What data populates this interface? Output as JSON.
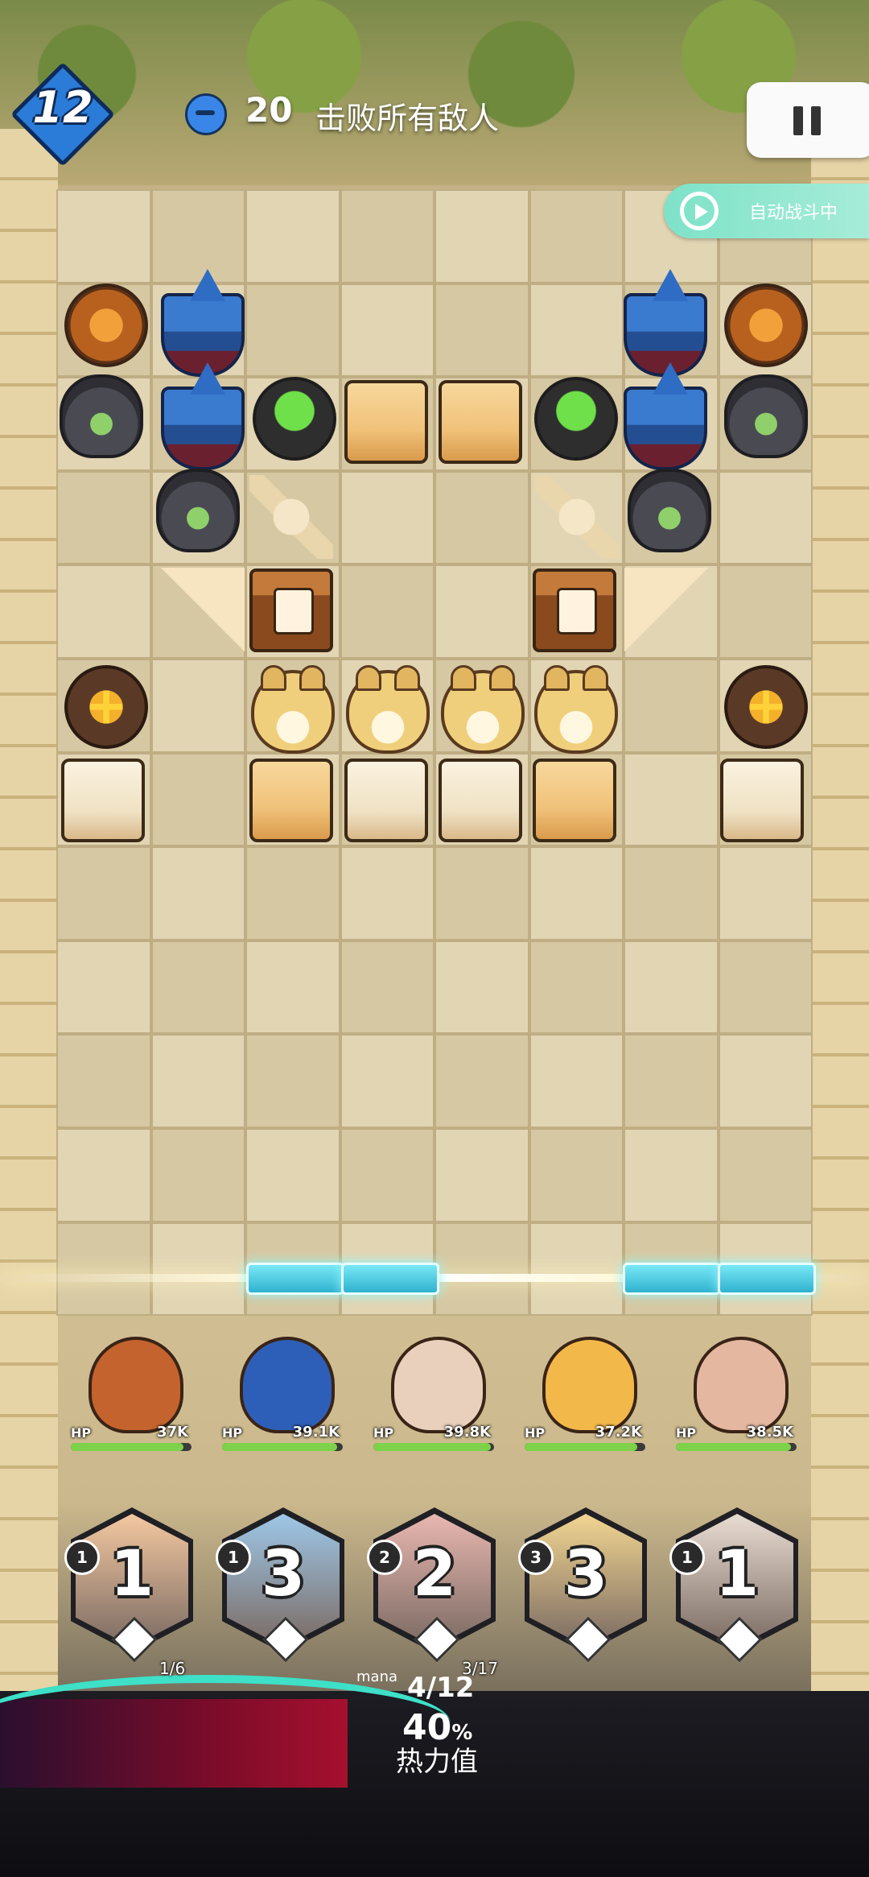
{
  "header": {
    "level": "12",
    "enemy_count": "20",
    "objective": "击败所有敌人",
    "auto_battle_label": "自动战斗中"
  },
  "heroes": [
    {
      "hp_label": "HP",
      "hp_value": "37K",
      "hp_fraction": 0.93,
      "hair": "#c4632e"
    },
    {
      "hp_label": "HP",
      "hp_value": "39.1K",
      "hp_fraction": 0.95,
      "hair": "#2e5fb8"
    },
    {
      "hp_label": "HP",
      "hp_value": "39.8K",
      "hp_fraction": 0.97,
      "hair": "#e8d0bc"
    },
    {
      "hp_label": "HP",
      "hp_value": "37.2K",
      "hp_fraction": 0.93,
      "hair": "#f3b84a"
    },
    {
      "hp_label": "HP",
      "hp_value": "38.5K",
      "hp_fraction": 0.95,
      "hair": "#e3b7a0"
    }
  ],
  "cards": [
    {
      "number": "1",
      "cost": "1",
      "sub": "1/6",
      "tint": "#f4c8a0"
    },
    {
      "number": "3",
      "cost": "1",
      "sub": "",
      "tint": "#9ec7e8"
    },
    {
      "number": "2",
      "cost": "2",
      "sub": "3/17",
      "tint": "#e8b7b0"
    },
    {
      "number": "3",
      "cost": "3",
      "sub": "",
      "tint": "#f2d591"
    },
    {
      "number": "1",
      "cost": "1",
      "sub": "",
      "tint": "#e9dcd2"
    }
  ],
  "bottom": {
    "mana_tag": "mana",
    "mana_value": "4/12",
    "heat_percent": "40",
    "heat_percent_sign": "%",
    "heat_label": "热力值"
  },
  "icons": {
    "pause": "pause-icon",
    "auto": "auto-play-icon",
    "enemy": "enemy-face-icon"
  }
}
